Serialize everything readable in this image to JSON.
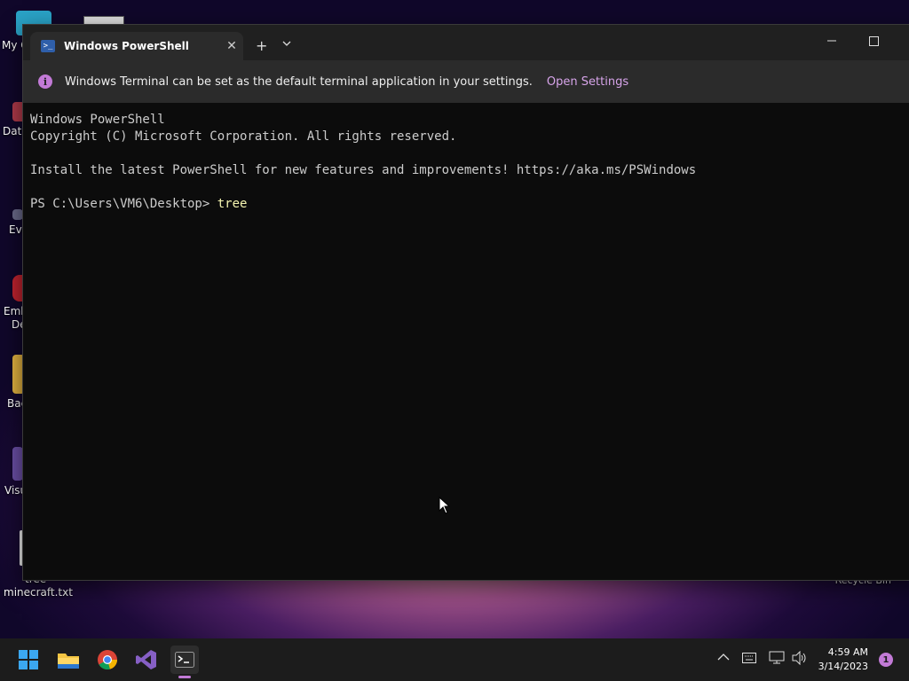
{
  "desktop": {
    "icons": [
      {
        "label": "My C"
      },
      {
        "label": "Data"
      },
      {
        "label": "Eve"
      },
      {
        "label": "Emb"
      },
      {
        "label": "De"
      },
      {
        "label": "Bac"
      },
      {
        "label": "Visu"
      },
      {
        "label": "tree"
      },
      {
        "label": "minecraft.txt"
      }
    ],
    "recycle_bin_label": "Recycle Bin"
  },
  "window": {
    "tab_title": "Windows PowerShell",
    "tab_close": "✕",
    "new_tab": "+",
    "dropdown": "⌄",
    "minimize": "—"
  },
  "infobar": {
    "icon": "i",
    "message": "Windows Terminal can be set as the default terminal application in your settings.",
    "link": "Open Settings",
    "close": "✕"
  },
  "console": {
    "line1": "Windows PowerShell",
    "line2": "Copyright (C) Microsoft Corporation. All rights reserved.",
    "line3": "Install the latest PowerShell for new features and improvements! https://aka.ms/PSWindows",
    "prompt": "PS C:\\Users\\VM6\\Desktop> ",
    "command": "tree"
  },
  "taskbar": {
    "apps": [
      {
        "name": "start-icon"
      },
      {
        "name": "file-explorer-icon"
      },
      {
        "name": "chrome-icon"
      },
      {
        "name": "visual-studio-icon"
      },
      {
        "name": "terminal-icon"
      }
    ],
    "time": "4:59 AM",
    "date": "3/14/2023",
    "notification_count": "1"
  },
  "colors": {
    "accent": "#c27ad6",
    "console_bg": "#0c0c0c",
    "taskbar_bg": "#1c1c1c"
  }
}
